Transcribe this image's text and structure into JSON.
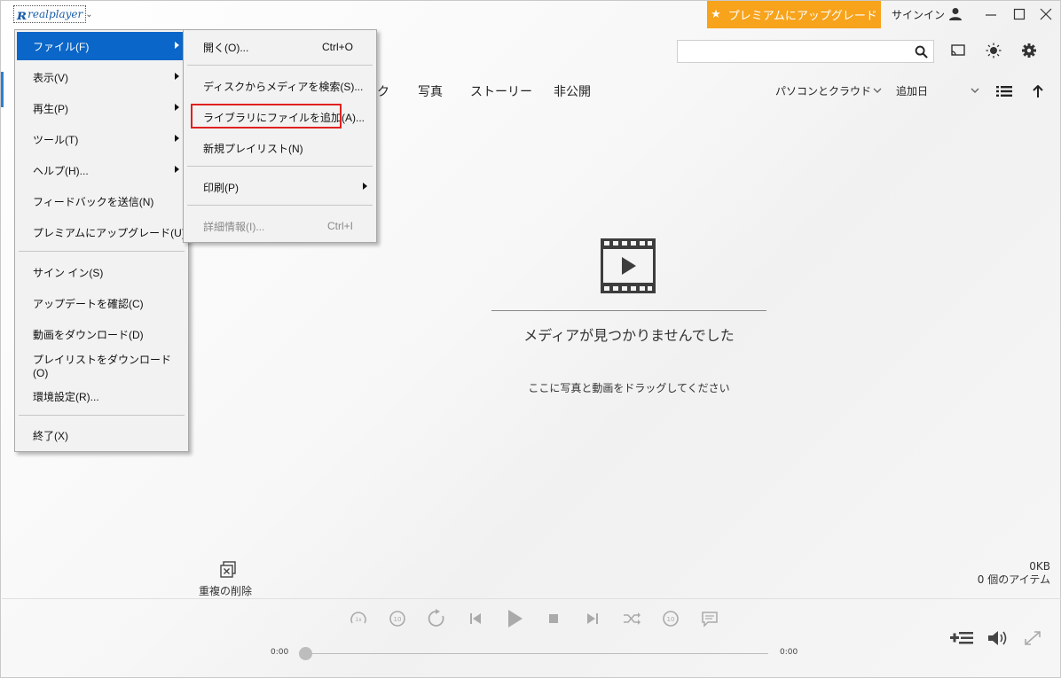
{
  "app": {
    "logo_text": "realplayer"
  },
  "titlebar": {
    "premium_label": "プレミアムにアップグレード",
    "premium_star": "★",
    "signin_label": "サインイン",
    "accent_color": "#f7a31c"
  },
  "search": {
    "value": "",
    "placeholder": ""
  },
  "tabs": {
    "partial": "ク",
    "photo": "写真",
    "story": "ストーリー",
    "private": "非公開"
  },
  "filters": {
    "source": "パソコンとクラウド",
    "sort": "追加日"
  },
  "empty_state": {
    "title": "メディアが見つかりませんでした",
    "subtitle": "ここに写真と動画をドラッグしてください"
  },
  "footer": {
    "dedupe_label": "重複の削除",
    "size": "0KB",
    "count": "0 個のアイテム",
    "time_start": "0:00",
    "time_end": "0:00"
  },
  "menu_main": {
    "items": [
      {
        "label": "ファイル(F)",
        "has_submenu": true,
        "active": true
      },
      {
        "label": "表示(V)",
        "has_submenu": true
      },
      {
        "label": "再生(P)",
        "has_submenu": true
      },
      {
        "label": "ツール(T)",
        "has_submenu": true
      },
      {
        "label": "ヘルプ(H)...",
        "has_submenu": true
      },
      {
        "label": "フィードバックを送信(N)"
      },
      {
        "label": "プレミアムにアップグレード(U)"
      },
      {
        "label": "サイン イン(S)"
      },
      {
        "label": "アップデートを確認(C)"
      },
      {
        "label": "動画をダウンロード(D)"
      },
      {
        "label": "プレイリストをダウンロード(O)"
      },
      {
        "label": "環境設定(R)..."
      },
      {
        "label": "終了(X)"
      }
    ]
  },
  "menu_file": {
    "items": [
      {
        "label": "開く(O)...",
        "shortcut": "Ctrl+O"
      },
      {
        "label": "ディスクからメディアを検索(S)..."
      },
      {
        "label": "ライブラリにファイルを追加(A)...",
        "highlighted": true
      },
      {
        "label": "新規プレイリスト(N)"
      },
      {
        "label": "印刷(P)",
        "has_submenu": true
      },
      {
        "label": "詳細情報(I)...",
        "shortcut": "Ctrl+I",
        "disabled": true
      }
    ]
  }
}
